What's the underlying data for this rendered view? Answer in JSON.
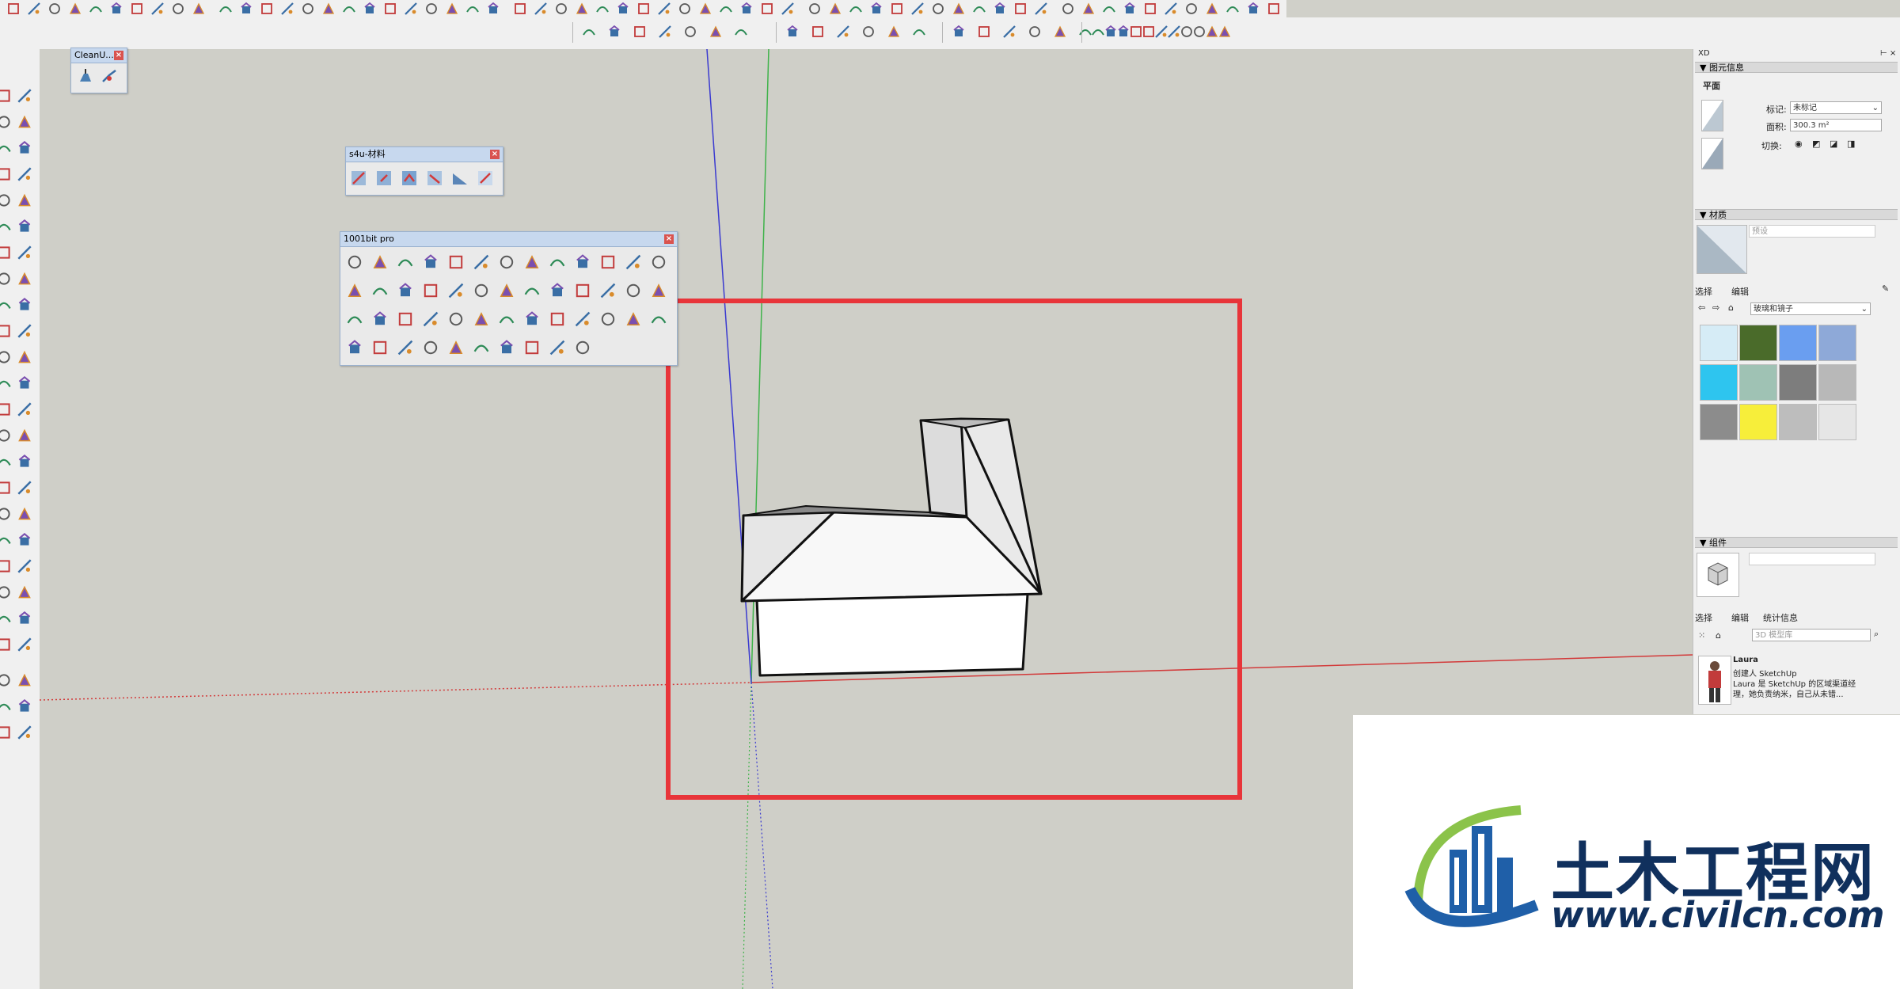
{
  "panels": {
    "cleanup": {
      "title": "CleanU..."
    },
    "s4u": {
      "title": "s4u-材料"
    },
    "bit1001": {
      "title": "1001bit pro"
    },
    "close_glyph": "×"
  },
  "tray": {
    "title": "XD",
    "entity_info": {
      "header": "▼ 图元信息",
      "type": "平面",
      "tag_label": "标记:",
      "tag_value": "未标记",
      "area_label": "面积:",
      "area_value": "300.3 m²",
      "toggle_label": "切换:"
    },
    "materials": {
      "header": "▼ 材质",
      "name_placeholder": "预设",
      "tab_select": "选择",
      "tab_edit": "编辑",
      "collection": "玻璃和镜子",
      "swatches": [
        "#d6ecf6",
        "#4a6b2a",
        "#6a9ef0",
        "#8ea9d8",
        "#2ec5ef",
        "#9fc2b4",
        "#7d7d7d",
        "#b8b8b8",
        "#8c8c8c",
        "#f7ee3a",
        "#bdbdbd",
        "#e6e6e6"
      ]
    },
    "components": {
      "header": "▼ 组件",
      "tab_select": "选择",
      "tab_edit": "编辑",
      "tab_stats": "统计信息",
      "search_placeholder": "3D 模型库",
      "item_name": "Laura",
      "item_line1": "创建人 SketchUp",
      "item_line2": "Laura 是 SketchUp 的区域渠道经",
      "item_line3": "理，她负责纳米，自己从未错..."
    }
  },
  "watermark": {
    "text": "土木工程网",
    "url": "www.civilcn.com"
  },
  "colors": {
    "highlight_rect": "#e8353a",
    "axis_red": "#d23a3a",
    "axis_green": "#3fb34a",
    "axis_blue": "#3a3ad0"
  }
}
